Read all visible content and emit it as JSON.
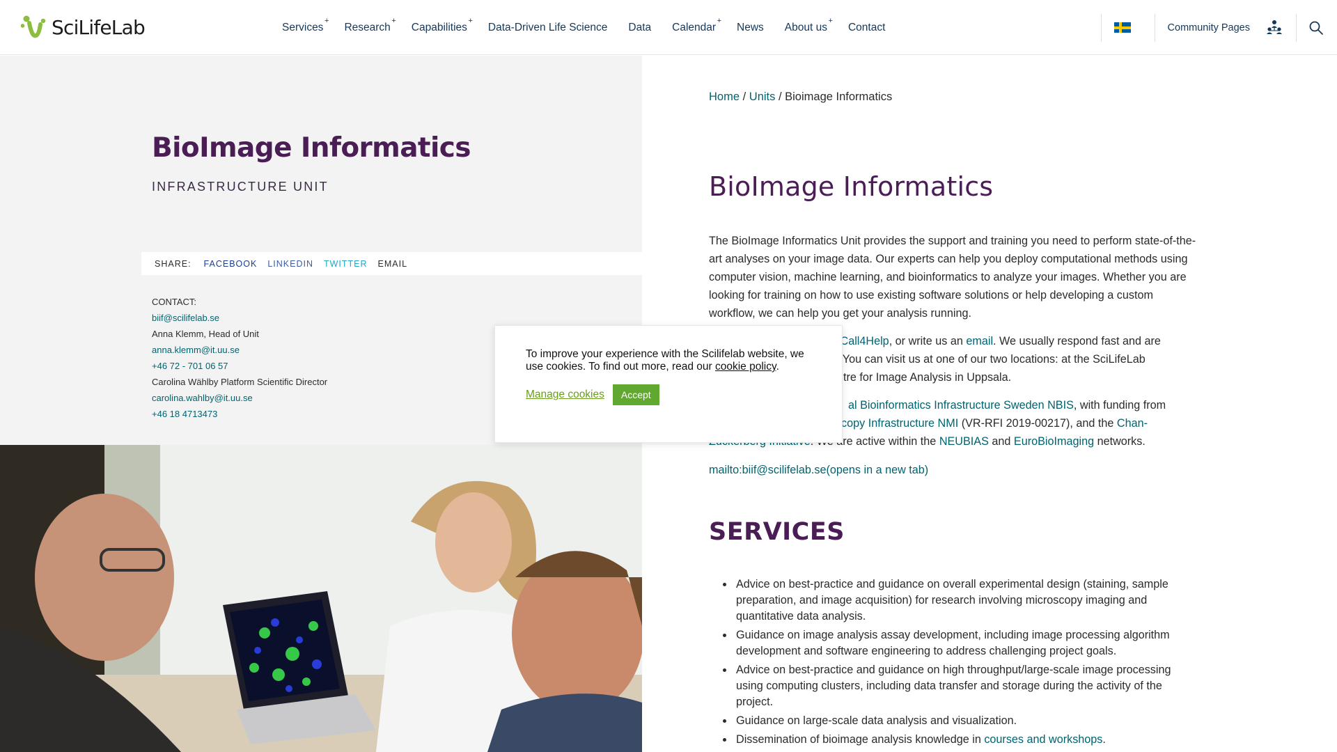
{
  "header": {
    "logo_text": "SciLifeLab",
    "nav": [
      {
        "label": "Services",
        "plus": "+"
      },
      {
        "label": "Research",
        "plus": "+"
      },
      {
        "label": "Capabilities",
        "plus": "+"
      },
      {
        "label": "Data-Driven Life Science",
        "plus": ""
      },
      {
        "label": "Data",
        "plus": ""
      },
      {
        "label": "Calendar",
        "plus": "+"
      },
      {
        "label": "News",
        "plus": ""
      },
      {
        "label": "About us",
        "plus": "+"
      },
      {
        "label": "Contact",
        "plus": ""
      }
    ],
    "community_label": "Community Pages",
    "icons": {
      "flag": "swedish-flag-icon",
      "community": "community-people-icon",
      "search": "search-icon"
    }
  },
  "unit": {
    "title": "BioImage Informatics",
    "subtitle": "INFRASTRUCTURE UNIT"
  },
  "share": {
    "label": "SHARE:",
    "facebook": "FACEBOOK",
    "linkedin": "LINKEDIN",
    "twitter": "TWITTER",
    "email": "EMAIL"
  },
  "contact": {
    "label": "CONTACT:",
    "email": "biif@scilifelab.se",
    "person1": "Anna Klemm, Head of Unit",
    "person1_email": "anna.klemm@it.uu.se",
    "person1_phone": "+46 72 - 701 06 57",
    "person2": "Carolina Wählby Platform Scientific Director",
    "person2_email": "carolina.wahlby@it.uu.se",
    "person2_phone": "+46 18 4713473"
  },
  "breadcrumb": {
    "home": "Home",
    "sep1": " / ",
    "units": "Units",
    "sep2": " / ",
    "current": "Bioimage Informatics"
  },
  "main": {
    "title": "BioImage Informatics",
    "intro": "The BioImage Informatics Unit provides the support and training you need to perform state-of-the-art analyses on your image data. Our experts can help you deploy computational methods using computer vision, machine learning, and bioinformatics to analyze your images. Whether you are looking for training on how to use existing software solutions or help developing a custom workflow, we can help you get your analysis running.",
    "p2_a": "a Call4Help",
    "p2_b": ", or write us an ",
    "p2_email": "email",
    "p2_c": ". We usually respond fast and are",
    "p2_d": "s. You can visit us at one of our two locations: at the SciLifeLab",
    "p2_e": "entre for Image Analysis in Uppsala.",
    "p3_nbis": "al Bioinformatics Infrastructure Sweden NBIS",
    "p3_a": ", with funding from",
    "p3_nmi": "copy Infrastructure NMI",
    "p3_b": " (VR-RFI 2019-00217), and the ",
    "p3_chan": "Chan-",
    "p3_czi": "Zuckerberg Initiative",
    "p3_c": ". We are active within the ",
    "p3_neubias": "NEUBIAS",
    "p3_d": " and ",
    "p3_ebi": "EuroBioImaging",
    "p3_e": " networks.",
    "mailto": "mailto:biif@scilifelab.se(opens in a new tab)",
    "services_title": "SERVICES",
    "services": [
      "Advice on best-practice and guidance on overall experimental design (staining, sample preparation, and image acquisition) for research involving microscopy imaging and quantitative data analysis.",
      "Guidance on image analysis assay development, including image processing algorithm development and software engineering to address challenging project goals.",
      "Advice on best-practice and guidance on high throughput/large-scale image processing using computing clusters, including data transfer and storage during the activity of the project.",
      "Guidance on large-scale data analysis and visualization."
    ],
    "service5_a": "Dissemination of bioimage analysis knowledge in ",
    "service5_link": "courses and workshops",
    "service5_b": "."
  },
  "cookie": {
    "text": "To improve your experience with the Scilifelab website, we use cookies. To find out more, read our ",
    "policy_link": "cookie policy",
    "text_end": ".",
    "manage": "Manage cookies",
    "accept": "Accept"
  },
  "colors": {
    "brand_purple": "#4b1d55",
    "link_teal": "#00636f",
    "nav_blue": "#13385a",
    "accept_green": "#61a830",
    "facebook": "#1a3e8c",
    "linkedin": "#3d5aa8",
    "twitter": "#1ea7c6"
  }
}
